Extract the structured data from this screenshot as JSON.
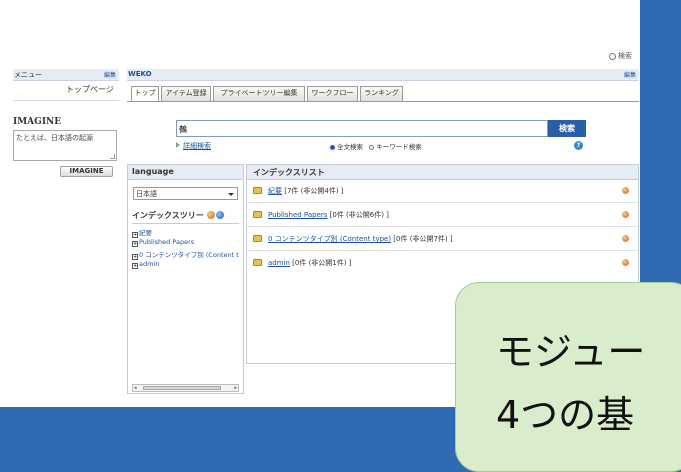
{
  "top": {
    "search_label": "検索"
  },
  "menu": {
    "title": "メニュー",
    "edit": "編集",
    "top_page": "トップページ"
  },
  "imagine": {
    "title": "IMAGINE",
    "placeholder": "たとえば、日本語の起源",
    "button": "IMAGINE"
  },
  "weko": {
    "title": "WEKO",
    "edit": "編集",
    "tabs": [
      "トップ",
      "アイテム登録",
      "プライベートツリー編集",
      "ワークフロー",
      "ランキング"
    ],
    "active_tab": 0
  },
  "search": {
    "value": "鵺",
    "button": "検索",
    "advanced_link": "詳細検索",
    "options": [
      "全文検索",
      "キーワード検索"
    ],
    "selected_option": 0,
    "help": "?"
  },
  "language": {
    "title": "language",
    "selected": "日本語",
    "tree_title": "インデックスツリー",
    "tree_items": [
      "紀要",
      "Published Papers",
      "0 コンテンツタイプ別 (Content t",
      "admin"
    ]
  },
  "index_list": {
    "title": "インデックスリスト",
    "rows": [
      {
        "name": "紀要",
        "suffix": " [7件 (非公開4件) ]",
        "linked": true
      },
      {
        "name": "Published Papers",
        "suffix": " [0件 (非公開6件) ]",
        "linked": true
      },
      {
        "name": "0 コンテンツタイプ別 (Content type)",
        "suffix": " [0件 (非公開7件) ]",
        "linked": true
      },
      {
        "name": "admin",
        "suffix": " [0件 (非公開1件) ]",
        "linked": true
      }
    ]
  },
  "callout": {
    "line1": "モジュー",
    "line2": "4つの基"
  }
}
